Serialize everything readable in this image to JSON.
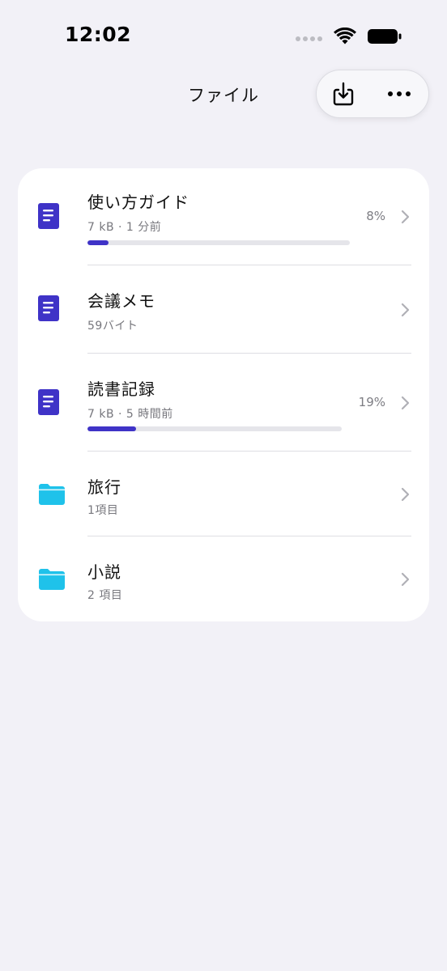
{
  "status_bar": {
    "time": "12:02"
  },
  "header": {
    "title": "ファイル",
    "download_icon": "download-tray-icon",
    "more_icon": "ellipsis-icon"
  },
  "colors": {
    "accent": "#3f33c7",
    "folder": "#1fc2ea",
    "background": "#f2f1f7",
    "card": "#ffffff"
  },
  "files": [
    {
      "type": "document",
      "icon": "document-icon",
      "title": "使い方ガイド",
      "meta": "7 kB  ·  1 分前",
      "percent": "8%",
      "progress": 0.08
    },
    {
      "type": "document",
      "icon": "document-icon",
      "title": "会議メモ",
      "meta": "59バイト"
    },
    {
      "type": "document",
      "icon": "document-icon",
      "title": "読書記録",
      "meta": "7 kB  ·  5 時間前",
      "percent": "19%",
      "progress": 0.19
    },
    {
      "type": "folder",
      "icon": "folder-icon",
      "title": "旅行",
      "meta": "1項目"
    },
    {
      "type": "folder",
      "icon": "folder-icon",
      "title": "小説",
      "meta": "2 項目"
    }
  ]
}
